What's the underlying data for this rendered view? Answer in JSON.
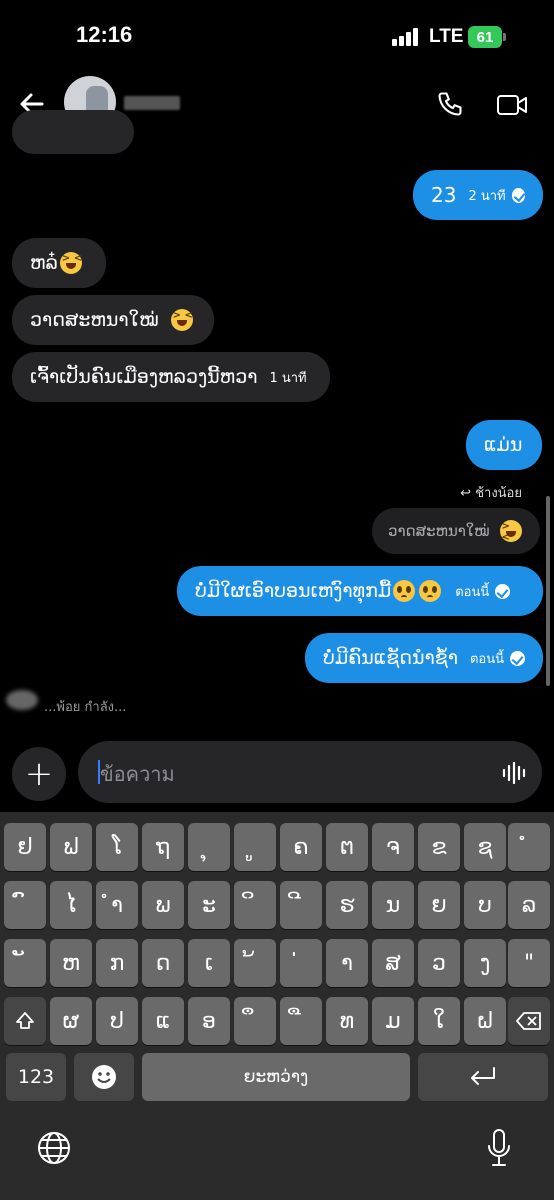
{
  "status": {
    "time": "12:16",
    "network": "LTE",
    "battery": "61"
  },
  "header": {
    "avatar": "avatar",
    "name_hidden": true
  },
  "messages": [
    {
      "text": "23",
      "time": "2 นาที",
      "side": "out"
    },
    {
      "text": "ຫລ໋",
      "side": "in",
      "emoji": "laugh"
    },
    {
      "text": "ວາດສະຫນາໃໝ່",
      "side": "in",
      "emoji": "laugh"
    },
    {
      "text": "ເຈົ້າເປັນຄົນເມືອງຫລວງນີ້ຫວາ",
      "time": "1 นาที",
      "side": "in"
    },
    {
      "text": "ແມ່ນ",
      "side": "out"
    },
    {
      "text": "ບໍ່ມີໃຜເອົາບອນເຫງົາທຸກມື້",
      "time": "ตอนนี้",
      "side": "out",
      "emoji": "plead"
    },
    {
      "text": "ບໍ່ມີຄົນແຊັດນຳຊ້ຳ",
      "time": "ตอนนี้",
      "side": "out"
    }
  ],
  "reply": {
    "label": "ช้างน้อย",
    "quoted": "ວາດສະຫນາໃໝ່"
  },
  "typing": "...พ้อย กำลัง...",
  "composer": {
    "placeholder": "ข้อความ"
  },
  "keyboard": {
    "row1": [
      "ຢ",
      "ຟ",
      "ໂ",
      "ຖ",
      "ຸ",
      "ູ",
      "ຄ",
      "ຕ",
      "ຈ",
      "ຂ",
      "ຊ",
      "ໍ"
    ],
    "row2": [
      "ົ",
      "ໄ",
      "ຳ",
      "ພ",
      "ະ",
      "ິ",
      "ີ",
      "ຮ",
      "ນ",
      "ຍ",
      "ບ",
      "ລ"
    ],
    "row3": [
      "ັ",
      "ຫ",
      "ກ",
      "ດ",
      "ເ",
      "້",
      "່",
      "າ",
      "ສ",
      "ວ",
      "ງ",
      "\""
    ],
    "row4": [
      "ຜ",
      "ປ",
      "ແ",
      "ອ",
      "ຶ",
      "ື",
      "ທ",
      "ມ",
      "ໃ",
      "ຝ"
    ],
    "num_label": "123",
    "space_label": "ຍະຫວ່າງ"
  },
  "colors": {
    "outgoing": "#1d8fe5",
    "incoming": "#262628",
    "battery": "#34c759"
  }
}
